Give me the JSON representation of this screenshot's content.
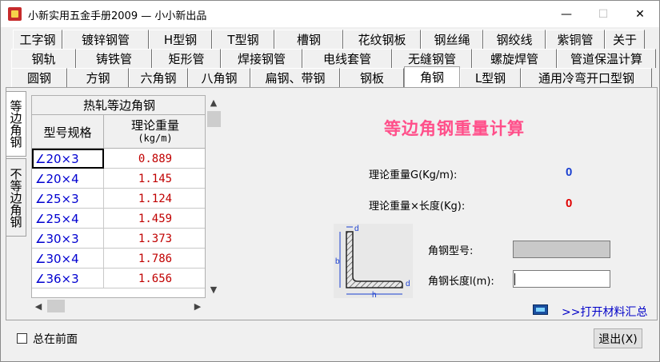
{
  "window": {
    "title": "小新实用五金手册2009 — 小小新出品",
    "minimize": "—",
    "maximize": "☐",
    "close": "✕"
  },
  "tabs": {
    "row1": [
      "工字钢",
      "镀锌钢管",
      "H型钢",
      "T型钢",
      "槽钢",
      "花纹钢板",
      "钢丝绳",
      "钢绞线",
      "紫铜管",
      "关于"
    ],
    "row2": [
      "钢轨",
      "铸铁管",
      "矩形管",
      "焊接钢管",
      "电线套管",
      "无缝钢管",
      "螺旋焊管",
      "管道保温计算"
    ],
    "row3": [
      "圆钢",
      "方钢",
      "六角钢",
      "八角钢",
      "扁钢、带钢",
      "钢板",
      "角钢",
      "L型钢",
      "通用冷弯开口型钢"
    ],
    "active": "角钢"
  },
  "side_tabs": {
    "equal": "等边角钢",
    "unequal": "不等边角钢"
  },
  "table": {
    "title": "热轧等边角钢",
    "col_spec": "型号规格",
    "col_weight": "理论重量",
    "col_weight_unit": "(kg/m)",
    "rows": [
      {
        "spec": "∠20×3",
        "weight": "0.889"
      },
      {
        "spec": "∠20×4",
        "weight": "1.145"
      },
      {
        "spec": "∠25×3",
        "weight": "1.124"
      },
      {
        "spec": "∠25×4",
        "weight": "1.459"
      },
      {
        "spec": "∠30×3",
        "weight": "1.373"
      },
      {
        "spec": "∠30×4",
        "weight": "1.786"
      },
      {
        "spec": "∠36×3",
        "weight": "1.656"
      }
    ]
  },
  "calc": {
    "title": "等边角钢重量计算",
    "weight_label": "理论重量G(Kg/m):",
    "weight_value": "0",
    "total_label": "理论重量×长度(Kg):",
    "total_value": "0",
    "type_label": "角钢型号:",
    "type_value": "",
    "length_label": "角钢长度l(m):",
    "length_value": "",
    "colors": {
      "title": "#ff4f8a",
      "weight_value": "#1a3fd0",
      "total_value": "#e00000"
    }
  },
  "diagram": {
    "b": "b",
    "d": "d",
    "h": "h"
  },
  "material_link": ">>打开材料汇总",
  "always_on_top": "总在前面",
  "exit_button": "退出(X)"
}
